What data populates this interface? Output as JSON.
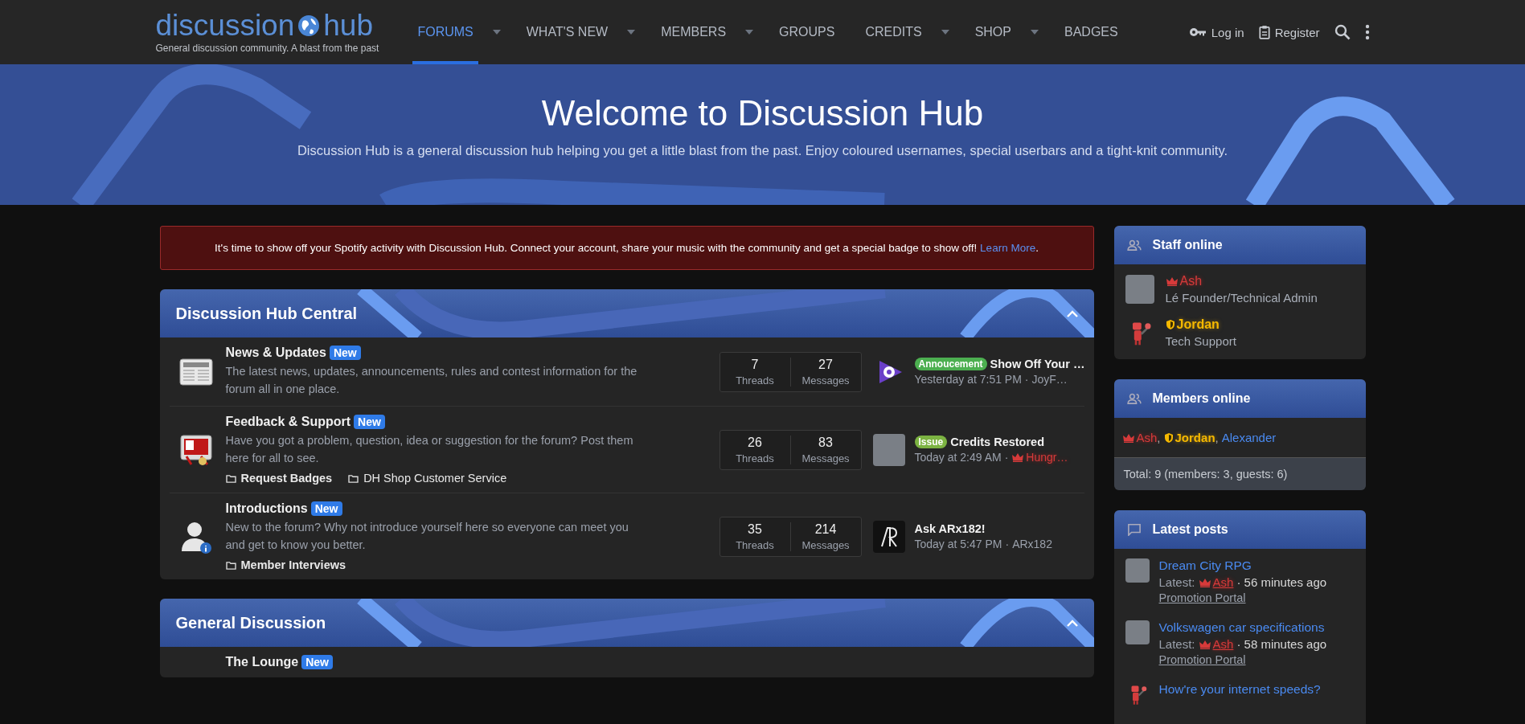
{
  "header": {
    "logo": {
      "words": [
        "discussion",
        "hub"
      ],
      "tagline": "General discussion community. A blast from the past"
    },
    "nav": [
      {
        "label": "FORUMS",
        "selected": true,
        "dropdown": true
      },
      {
        "label": "WHAT'S NEW",
        "selected": false,
        "dropdown": true
      },
      {
        "label": "MEMBERS",
        "selected": false,
        "dropdown": true
      },
      {
        "label": "GROUPS",
        "selected": false,
        "dropdown": false
      },
      {
        "label": "CREDITS",
        "selected": false,
        "dropdown": true
      },
      {
        "label": "SHOP",
        "selected": false,
        "dropdown": true
      },
      {
        "label": "BADGES",
        "selected": false,
        "dropdown": false
      }
    ],
    "login": "Log in",
    "register": "Register"
  },
  "banner": {
    "title": "Welcome to Discussion Hub",
    "subtitle": "Discussion Hub is a general discussion hub helping you get a little blast from the past. Enjoy coloured usernames, special userbars and a tight-knit community."
  },
  "notice": {
    "text": "It's time to show off your Spotify activity with Discussion Hub. Connect your account, share your music with the community and get a special badge to show off!",
    "link": "Learn More",
    "end": "."
  },
  "categories": [
    {
      "title": "Discussion Hub Central",
      "expanded": true,
      "forums": [
        {
          "title": "News & Updates",
          "badge": "New",
          "description": "The latest news, updates, announcements, rules and contest information for the forum all in one place.",
          "threads": "7",
          "threads_label": "Threads",
          "messages": "27",
          "messages_label": "Messages",
          "latest": {
            "prefix": {
              "label": "Annoucement",
              "color": "#4caf50"
            },
            "title": "Show Off Your …",
            "time": "Yesterday at 7:51 PM",
            "separator": "·",
            "user": {
              "name": "JoyF…",
              "kind": "plain"
            }
          }
        },
        {
          "title": "Feedback & Support",
          "badge": "New",
          "description": "Have you got a problem, question, idea or suggestion for the forum? Post them here for all to see.",
          "subforums": [
            {
              "label": "Request Badges",
              "bold": true
            },
            {
              "label": "DH Shop Customer Service",
              "bold": false
            }
          ],
          "threads": "26",
          "threads_label": "Threads",
          "messages": "83",
          "messages_label": "Messages",
          "latest": {
            "prefix": {
              "label": "Issue",
              "color": "#7cb342"
            },
            "title": "Credits Restored",
            "time": "Today at 2:49 AM",
            "separator": "·",
            "user": {
              "name": "Hungr…",
              "kind": "admin"
            }
          }
        },
        {
          "title": "Introductions",
          "badge": "New",
          "description": "New to the forum? Why not introduce yourself here so everyone can meet you and get to know you better.",
          "subforums": [
            {
              "label": "Member Interviews",
              "bold": true
            }
          ],
          "threads": "35",
          "threads_label": "Threads",
          "messages": "214",
          "messages_label": "Messages",
          "latest": {
            "title": "Ask ARx182!",
            "time": "Today at 5:47 PM",
            "separator": "·",
            "user": {
              "name": "ARx182",
              "kind": "plain"
            }
          }
        }
      ]
    },
    {
      "title": "General Discussion",
      "expanded": true,
      "forums": [
        {
          "title": "The Lounge",
          "badge": "New"
        }
      ]
    }
  ],
  "sidebar": {
    "staff_online": {
      "title": "Staff online",
      "staff": [
        {
          "name": "Ash",
          "kind": "admin",
          "rank": "Lé Founder/Technical Admin"
        },
        {
          "name": "Jordan",
          "kind": "support",
          "rank": "Tech Support"
        }
      ]
    },
    "members_online": {
      "title": "Members online",
      "users": [
        {
          "name": "Ash",
          "kind": "admin",
          "separator": ","
        },
        {
          "name": "Jordan",
          "kind": "support",
          "separator": ","
        },
        {
          "name": "Alexander",
          "kind": "member"
        }
      ],
      "total": "Total: 9 (members: 3, guests: 6)"
    },
    "latest_posts": {
      "title": "Latest posts",
      "posts": [
        {
          "title": "Dream City RPG",
          "latest_label": "Latest:",
          "user": {
            "name": "Ash",
            "kind": "admin"
          },
          "time": "· 56 minutes ago",
          "forum": "Promotion Portal"
        },
        {
          "title": "Volkswagen car specifications",
          "latest_label": "Latest:",
          "user": {
            "name": "Ash",
            "kind": "admin"
          },
          "time": "· 58 minutes ago",
          "forum": "Promotion Portal"
        },
        {
          "title": "How're your internet speeds?"
        }
      ]
    }
  }
}
